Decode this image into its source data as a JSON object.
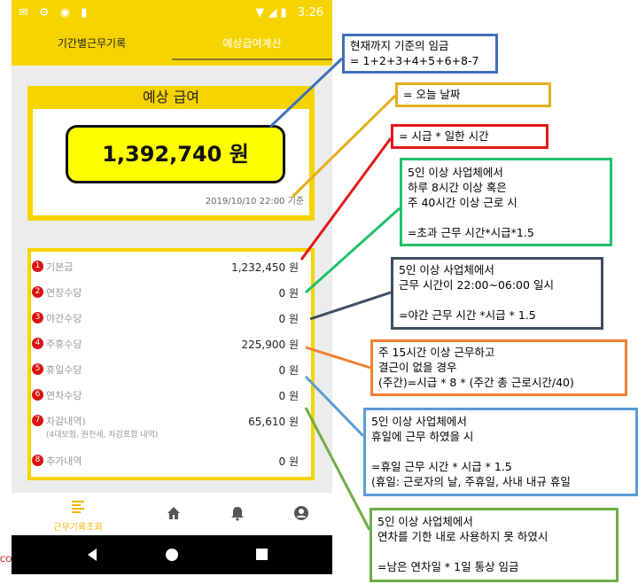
{
  "statusbar": {
    "time": "3:26"
  },
  "tabs": [
    {
      "label": "기간별근무기록"
    },
    {
      "label": "예상급여계산"
    }
  ],
  "summary": {
    "title": "예상 급여",
    "amount": "1,392,740 원",
    "base_date": "2019/10/10 22:00 기준"
  },
  "items": [
    {
      "num": "1",
      "label": "기본급",
      "amount": "1,232,450 원"
    },
    {
      "num": "2",
      "label": "연장수당",
      "amount": "0 원"
    },
    {
      "num": "3",
      "label": "야간수당",
      "amount": "0 원"
    },
    {
      "num": "4",
      "label": "주휴수당",
      "amount": "225,900 원"
    },
    {
      "num": "5",
      "label": "휴일수당",
      "amount": "0 원"
    },
    {
      "num": "6",
      "label": "연차수당",
      "amount": "0 원"
    },
    {
      "num": "7",
      "label": "차감내역)",
      "sublabel": "(4대보험, 원천세, 차감포함 내역)",
      "amount": "65,610 원"
    },
    {
      "num": "8",
      "label": "추가내역",
      "amount": "0 원"
    }
  ],
  "nav": {
    "records_label": "근무기록조회"
  },
  "icons": {
    "home": "home-icon",
    "bell": "bell-icon",
    "profile": "profile-icon",
    "list": "list-icon"
  },
  "colors": {
    "accent": "#f6d400",
    "pill": "#ffff00"
  },
  "callouts": {
    "c1": "현재까지 기준의 임금\n= 1+2+3+4+5+6+8-7",
    "c2": "= 오늘 날짜",
    "c3": "= 시급 * 일한 시간",
    "c4": "5인 이상 사업체에서\n하루 8시간 이상 혹은\n주 40시간 이상 근로 시\n\n=초과 근무 시간*시급*1.5",
    "c5": "5인 이상 사업체에서\n근무 시간이 22:00~06:00 일시\n\n=야간 근무 시간 *시급 * 1.5",
    "c6": "주 15시간 이상 근무하고\n결근이 없을 경우\n(주간)=시급 * 8 * (주간 총 근로시간/40)",
    "c7": "5인 이상 사업체에서\n휴일에 근무 하였을 시\n\n=휴일 근무 시간 * 시급 * 1.5\n(휴일: 근로자의 날, 주휴일, 사내 내규 휴일",
    "c8": "5인 이상 사업체에서\n연차를 기한 내로 사용하지 못 하였시\n\n=남은 연차일 * 1일 통상 임금"
  },
  "corner_text": "CO"
}
